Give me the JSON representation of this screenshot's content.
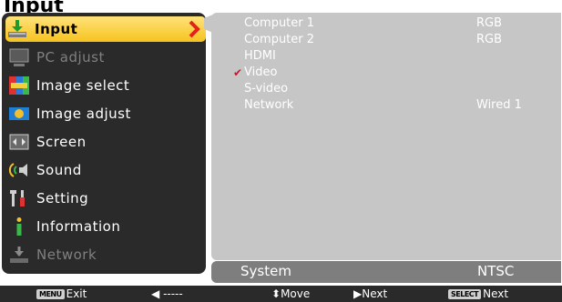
{
  "title": "Input",
  "menu": [
    {
      "label": "Input",
      "icon": "input-icon",
      "selected": true
    },
    {
      "label": "PC adjust",
      "icon": "pc-adjust-icon",
      "dim": true
    },
    {
      "label": "Image select",
      "icon": "image-select-icon"
    },
    {
      "label": "Image adjust",
      "icon": "image-adjust-icon"
    },
    {
      "label": "Screen",
      "icon": "screen-icon"
    },
    {
      "label": "Sound",
      "icon": "sound-icon"
    },
    {
      "label": "Setting",
      "icon": "setting-icon"
    },
    {
      "label": "Information",
      "icon": "information-icon"
    },
    {
      "label": "Network",
      "icon": "network-icon",
      "dim": true
    }
  ],
  "inputs": [
    {
      "label": "Computer 1",
      "value": "RGB"
    },
    {
      "label": "Computer 2",
      "value": "RGB"
    },
    {
      "label": "HDMI",
      "value": ""
    },
    {
      "label": "Video",
      "value": "",
      "checked": true
    },
    {
      "label": "S-video",
      "value": ""
    },
    {
      "label": "Network",
      "value": "Wired 1"
    }
  ],
  "system": {
    "label": "System",
    "value": "NTSC"
  },
  "footer": {
    "exit_key": "MENU",
    "exit_label": "Exit",
    "back_label": "-----",
    "move_label": "Move",
    "next_label": "Next",
    "select_key": "SELECT",
    "select_label": "Next"
  },
  "colors": {
    "selected": "#f6c31f",
    "menu_bg": "#2a2a2a",
    "panel_bg": "#c6c6c6",
    "check": "#c0192a"
  }
}
